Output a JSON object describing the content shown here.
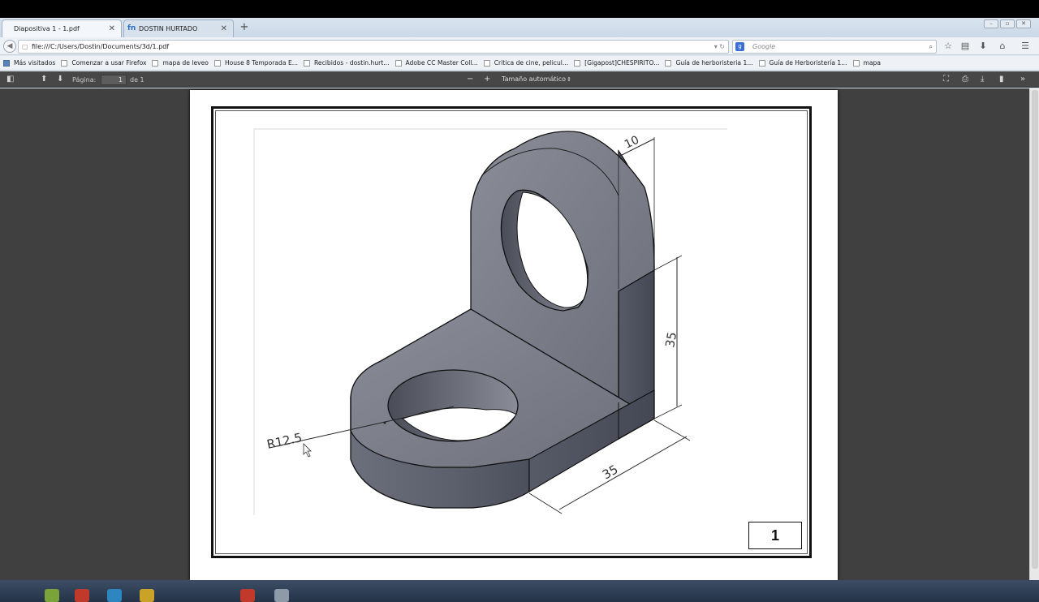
{
  "tabs": [
    {
      "label": "Diapositiva 1 - 1.pdf",
      "active": true
    },
    {
      "label": "DOSTIN HURTADO",
      "favicon": "fn",
      "active": false
    }
  ],
  "nav": {
    "url": "file:///C:/Users/Dostin/Documents/3d/1.pdf",
    "search_placeholder": "Google"
  },
  "bookmarks": [
    "Más visitados",
    "Comenzar a usar Firefox",
    "mapa de leveo",
    "House 8 Temporada E...",
    "Recibidos - dostin.hurt...",
    "Adobe CC Master Coll...",
    "Critica de cine, pelicul...",
    "[Gigapost]CHESPIRITO...",
    "Guía de herboristeria 1...",
    "Guía de Herboristería 1...",
    "mapa"
  ],
  "pdf_toolbar": {
    "page_label": "Página:",
    "page_value": "1",
    "page_of": "de 1",
    "zoom_label": "Tamaño automático"
  },
  "drawing": {
    "dim_radius": "R12.5",
    "dim_top": "10",
    "dim_height": "35",
    "dim_width": "35",
    "page_number": "1",
    "shade_color": "#5c5f6e"
  }
}
